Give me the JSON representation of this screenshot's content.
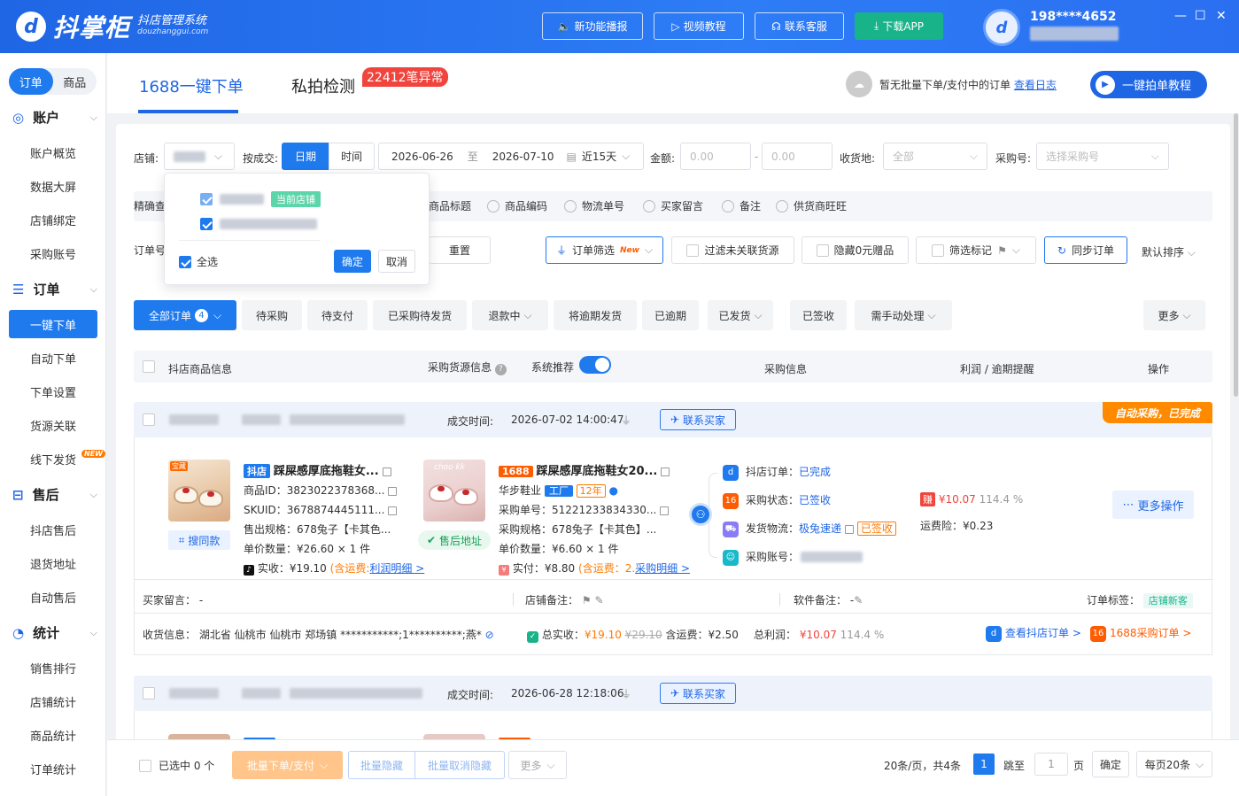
{
  "brand": {
    "logo_glyph": "d",
    "name": "抖掌柜",
    "subtitle": "抖店管理系统",
    "domain": "douzhanggui.com"
  },
  "header": {
    "buttons": [
      {
        "label": "新功能播报",
        "icon": "speaker-icon"
      },
      {
        "label": "视频教程",
        "icon": "video-icon"
      },
      {
        "label": "联系客服",
        "icon": "headset-icon"
      },
      {
        "label": "下载APP",
        "icon": "download-icon"
      }
    ],
    "user_phone": "198****4652",
    "window": {
      "min": "—",
      "max": "☐",
      "close": "✕"
    }
  },
  "sidebar": {
    "segment": {
      "orders": "订单",
      "products": "商品"
    },
    "sections": [
      {
        "title": "账户",
        "items": [
          "账户概览",
          "数据大屏",
          "店铺绑定",
          "采购账号"
        ]
      },
      {
        "title": "订单",
        "items": [
          "一键下单",
          "自动下单",
          "下单设置",
          "货源关联",
          "线下发货"
        ]
      },
      {
        "title": "售后",
        "items": [
          "抖店售后",
          "退货地址",
          "自动售后"
        ]
      },
      {
        "title": "统计",
        "items": [
          "销售排行",
          "店铺统计",
          "商品统计",
          "订单统计"
        ]
      }
    ],
    "new_badge": "NEW"
  },
  "tabs": {
    "one_click": "1688一键下单",
    "private": "私拍检测",
    "anomaly_badge": "22412笔异常"
  },
  "notice": {
    "text": "暂无批量下单/支付中的订单",
    "link": "查看日志"
  },
  "tutorial_btn": "一键拍单教程",
  "filters": {
    "store_label": "店铺:",
    "deal_label": "按成交:",
    "date_btn": "日期",
    "time_btn": "时间",
    "date_from": "2026-06-26",
    "date_to_sep": "至",
    "date_to": "2026-07-10",
    "range": "近15天",
    "amount_label": "金额:",
    "amount_min": "0.00",
    "amount_dash": "-",
    "amount_max": "0.00",
    "addr_label": "收货地:",
    "addr_value": "全部",
    "purchase_label": "采购号:",
    "purchase_ph": "选择采购号",
    "precise_label": "精确查",
    "precise_options": [
      "商品标题",
      "商品编码",
      "物流单号",
      "买家留言",
      "备注",
      "供货商旺旺"
    ],
    "order_no_label": "订单号",
    "reset": "重置",
    "order_filter": "订单筛选",
    "order_filter_badge": "New",
    "unlinked": "过滤未关联货源",
    "hide_zero": "隐藏0元赠品",
    "mark_filter": "筛选标记",
    "sync": "同步订单",
    "sort": "默认排序"
  },
  "store_popup": {
    "current_tag": "当前店铺",
    "select_all": "全选",
    "confirm": "确定",
    "cancel": "取消"
  },
  "status_tabs": [
    {
      "label": "全部订单",
      "count": "4"
    },
    {
      "label": "待采购"
    },
    {
      "label": "待支付"
    },
    {
      "label": "已采购待发货"
    },
    {
      "label": "退款中"
    },
    {
      "label": "将逾期发货"
    },
    {
      "label": "已逾期"
    },
    {
      "label": "已发货"
    },
    {
      "label": "已签收"
    },
    {
      "label": "需手动处理"
    },
    {
      "label": "更多"
    }
  ],
  "table_head": {
    "product": "抖店商品信息",
    "source": "采购货源信息",
    "recommend": "系统推荐",
    "purchase": "采购信息",
    "profit": "利润 / 逾期提醒",
    "ops": "操作"
  },
  "orders": [
    {
      "deal_time_label": "成交时间:",
      "deal_time": "2026-07-02 14:00:47",
      "contact": "联系买家",
      "ribbon": "自动采购，已完成",
      "dy": {
        "tag": "抖店",
        "title": "踩屎感厚底拖鞋女...",
        "id": "商品ID：3823022378368...",
        "sku": "SKUID：3678874445111...",
        "spec": "售出规格：678兔子【卡其色...",
        "qty": "单价数量：¥26.60 × 1 件",
        "paid": "实收：¥19.10",
        "freight": "(含运费:",
        "detail_link": "利润明细 >",
        "search_same": "搜同款",
        "img_label": "宝藏"
      },
      "src": {
        "tag": "1688",
        "title": "踩屎感厚底拖鞋女20...",
        "shop": "华步鞋业",
        "factory": "工厂",
        "years": "12年",
        "po": "采购单号：51221233834330...",
        "spec": "采购规格：678兔子【卡其色】...",
        "qty": "单价数量：¥6.60 × 1 件",
        "paid": "实付：¥8.80",
        "freight": "(含运费：2.",
        "detail_link": "采购明细 >",
        "after_sale": "售后地址",
        "img_label": "choo kk"
      },
      "purchase": {
        "dy_order_label": "抖店订单：",
        "dy_order": "已完成",
        "status_label": "采购状态：",
        "status": "已签收",
        "logistics_label": "发货物流：",
        "logistics": "极兔速递",
        "logistics_badge": "已签收",
        "account_label": "采购账号："
      },
      "profit": {
        "tag": "赚",
        "value": "¥10.07",
        "pct": "114.4 %",
        "ins_label": "运费险：",
        "ins": "¥0.23"
      },
      "more_ops": "更多操作",
      "remarks": {
        "buyer_label": "买家留言：",
        "buyer": "-",
        "store_label": "店铺备注：",
        "soft_label": "软件备注：",
        "soft": "-",
        "tag_label": "订单标签：",
        "tag": "店铺新客"
      },
      "address": {
        "label": "收货信息：",
        "text": "湖北省 仙桃市 仙桃市 郑场镇 ***********;1**********;燕*",
        "total_label": "总实收：",
        "total": "¥19.10",
        "total_orig": "¥29.10",
        "freight": "含运费：¥2.50",
        "profit_label": "总利润：",
        "profit": "¥10.07",
        "profit_pct": "114.4 %",
        "view_dy": "查看抖店订单 >",
        "view_1688": "1688采购订单 >"
      }
    },
    {
      "deal_time_label": "成交时间:",
      "deal_time": "2026-06-28 12:18:06",
      "contact": "联系买家"
    }
  ],
  "footer": {
    "selected": "已选中 0 个",
    "batch_order": "批量下单/支付",
    "batch_hide": "批量隐藏",
    "batch_unhide": "批量取消隐藏",
    "more": "更多",
    "page_info": "20条/页，共4条",
    "page": "1",
    "goto": "跳至",
    "goto_val": "1",
    "page_unit": "页",
    "confirm": "确定",
    "per_page": "每页20条"
  },
  "colors": {
    "primary": "#1f7aee",
    "header": "#2a6ff0",
    "orange": "#ff7a00",
    "red": "#f0443d",
    "green": "#19b38a"
  }
}
